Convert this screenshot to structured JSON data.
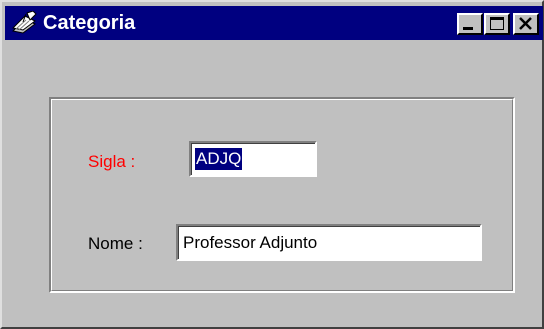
{
  "window": {
    "title": "Categoria",
    "title_icon": "notebook-pen-icon",
    "colors": {
      "titlebar": "#000080",
      "face": "#c0c0c0",
      "selection": "#000080",
      "required_label": "#ff0000"
    }
  },
  "titlebar_buttons": {
    "minimize_icon": "minimize-icon",
    "maximize_icon": "maximize-icon",
    "close_icon": "close-icon"
  },
  "form": {
    "sigla": {
      "label": "Sigla :",
      "value": "ADJQ",
      "selected": true
    },
    "nome": {
      "label": "Nome :",
      "value": "Professor Adjunto"
    }
  }
}
